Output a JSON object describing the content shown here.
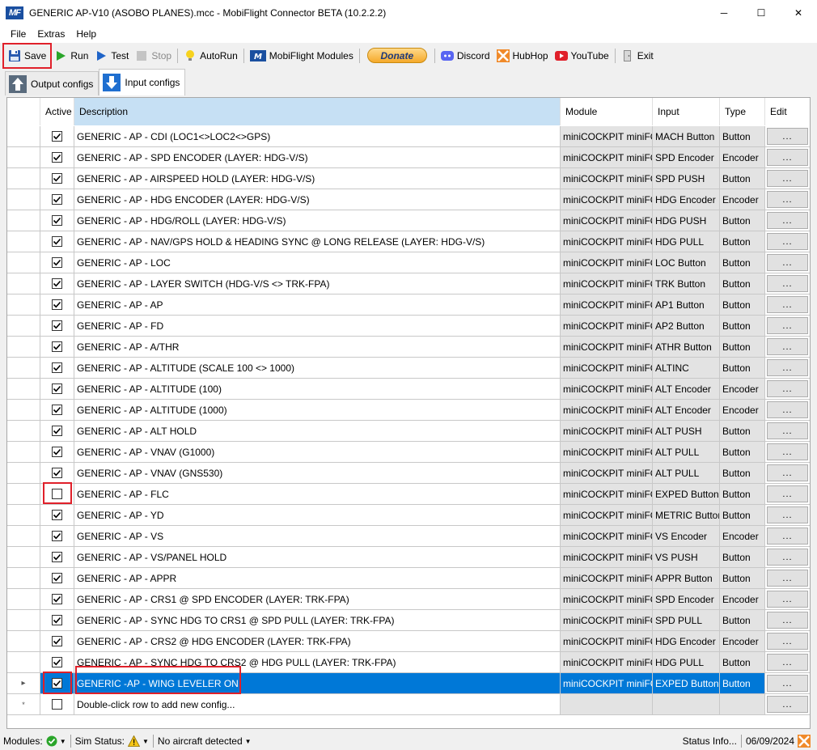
{
  "window": {
    "title": "GENERIC AP-V10 (ASOBO PLANES).mcc - MobiFlight Connector BETA (10.2.2.2)",
    "logo_text": "MF",
    "minimize_glyph": "─",
    "maximize_glyph": "☐",
    "close_glyph": "✕"
  },
  "menu": [
    "File",
    "Extras",
    "Help"
  ],
  "toolbar": {
    "save": "Save",
    "run": "Run",
    "test": "Test",
    "stop": "Stop",
    "autorun": "AutoRun",
    "modules": "MobiFlight Modules",
    "donate": "Donate",
    "discord": "Discord",
    "hubhop": "HubHop",
    "youtube": "YouTube",
    "exit": "Exit"
  },
  "tabs": [
    {
      "label": "Output configs",
      "active": false
    },
    {
      "label": "Input configs",
      "active": true
    }
  ],
  "grid": {
    "headers": {
      "active": "Active",
      "description": "Description",
      "module": "Module",
      "input": "Input",
      "type": "Type",
      "edit": "Edit"
    },
    "edit_label": "...",
    "new_row_marker": "*",
    "selected_marker": "▸",
    "new_row_text": "Double-click row to add new config...",
    "rows": [
      {
        "active": true,
        "description": "GENERIC - AP - CDI (LOC1<>LOC2<>GPS)",
        "module": "miniCOCKPIT miniFCU",
        "input": "MACH Button",
        "type": "Button"
      },
      {
        "active": true,
        "description": "GENERIC - AP - SPD ENCODER (LAYER: HDG-V/S)",
        "module": "miniCOCKPIT miniFCU",
        "input": "SPD Encoder",
        "type": "Encoder"
      },
      {
        "active": true,
        "description": "GENERIC - AP - AIRSPEED HOLD (LAYER: HDG-V/S)",
        "module": "miniCOCKPIT miniFCU",
        "input": "SPD PUSH",
        "type": "Button"
      },
      {
        "active": true,
        "description": "GENERIC - AP - HDG ENCODER (LAYER: HDG-V/S)",
        "module": "miniCOCKPIT miniFCU",
        "input": "HDG Encoder",
        "type": "Encoder"
      },
      {
        "active": true,
        "description": "GENERIC - AP - HDG/ROLL (LAYER: HDG-V/S)",
        "module": "miniCOCKPIT miniFCU",
        "input": "HDG PUSH",
        "type": "Button"
      },
      {
        "active": true,
        "description": "GENERIC - AP - NAV/GPS HOLD & HEADING SYNC @ LONG RELEASE (LAYER: HDG-V/S)",
        "module": "miniCOCKPIT miniFCU",
        "input": "HDG PULL",
        "type": "Button"
      },
      {
        "active": true,
        "description": "GENERIC - AP - LOC",
        "module": "miniCOCKPIT miniFCU",
        "input": "LOC Button",
        "type": "Button"
      },
      {
        "active": true,
        "description": "GENERIC - AP - LAYER SWITCH (HDG-V/S <> TRK-FPA)",
        "module": "miniCOCKPIT miniFCU",
        "input": "TRK Button",
        "type": "Button"
      },
      {
        "active": true,
        "description": "GENERIC - AP - AP",
        "module": "miniCOCKPIT miniFCU",
        "input": "AP1 Button",
        "type": "Button"
      },
      {
        "active": true,
        "description": "GENERIC - AP - FD",
        "module": "miniCOCKPIT miniFCU",
        "input": "AP2 Button",
        "type": "Button"
      },
      {
        "active": true,
        "description": "GENERIC - AP - A/THR",
        "module": "miniCOCKPIT miniFCU",
        "input": "ATHR Button",
        "type": "Button"
      },
      {
        "active": true,
        "description": "GENERIC - AP - ALTITUDE (SCALE 100 <> 1000)",
        "module": "miniCOCKPIT miniFCU",
        "input": "ALTINC",
        "type": "Button"
      },
      {
        "active": true,
        "description": "GENERIC - AP - ALTITUDE (100)",
        "module": "miniCOCKPIT miniFCU",
        "input": "ALT Encoder",
        "type": "Encoder"
      },
      {
        "active": true,
        "description": "GENERIC - AP - ALTITUDE (1000)",
        "module": "miniCOCKPIT miniFCU",
        "input": "ALT Encoder",
        "type": "Encoder"
      },
      {
        "active": true,
        "description": "GENERIC - AP - ALT HOLD",
        "module": "miniCOCKPIT miniFCU",
        "input": "ALT PUSH",
        "type": "Button"
      },
      {
        "active": true,
        "description": "GENERIC - AP - VNAV (G1000)",
        "module": "miniCOCKPIT miniFCU",
        "input": "ALT PULL",
        "type": "Button"
      },
      {
        "active": true,
        "description": "GENERIC - AP - VNAV (GNS530)",
        "module": "miniCOCKPIT miniFCU",
        "input": "ALT PULL",
        "type": "Button"
      },
      {
        "active": false,
        "description": "GENERIC - AP - FLC",
        "module": "miniCOCKPIT miniFCU",
        "input": "EXPED Button",
        "type": "Button"
      },
      {
        "active": true,
        "description": "GENERIC - AP - YD",
        "module": "miniCOCKPIT miniFCU",
        "input": "METRIC Button",
        "type": "Button"
      },
      {
        "active": true,
        "description": "GENERIC - AP - VS",
        "module": "miniCOCKPIT miniFCU",
        "input": "VS Encoder",
        "type": "Encoder"
      },
      {
        "active": true,
        "description": "GENERIC - AP - VS/PANEL HOLD",
        "module": "miniCOCKPIT miniFCU",
        "input": "VS PUSH",
        "type": "Button"
      },
      {
        "active": true,
        "description": "GENERIC - AP - APPR",
        "module": "miniCOCKPIT miniFCU",
        "input": "APPR Button",
        "type": "Button"
      },
      {
        "active": true,
        "description": "GENERIC - AP - CRS1 @ SPD ENCODER (LAYER: TRK-FPA)",
        "module": "miniCOCKPIT miniFCU",
        "input": "SPD Encoder",
        "type": "Encoder"
      },
      {
        "active": true,
        "description": "GENERIC - AP - SYNC HDG TO CRS1 @ SPD PULL (LAYER: TRK-FPA)",
        "module": "miniCOCKPIT miniFCU",
        "input": "SPD PULL",
        "type": "Button"
      },
      {
        "active": true,
        "description": "GENERIC - AP - CRS2 @ HDG ENCODER (LAYER: TRK-FPA)",
        "module": "miniCOCKPIT miniFCU",
        "input": "HDG Encoder",
        "type": "Encoder"
      },
      {
        "active": true,
        "description": "GENERIC - AP - SYNC HDG TO CRS2 @ HDG PULL (LAYER: TRK-FPA)",
        "module": "miniCOCKPIT miniFCU",
        "input": "HDG PULL",
        "type": "Button"
      },
      {
        "active": true,
        "description": "GENERIC -AP - WING LEVELER ON",
        "module": "miniCOCKPIT miniFCU",
        "input": "EXPED Button",
        "type": "Button",
        "selected": true
      }
    ]
  },
  "status": {
    "modules": "Modules:",
    "sim_status": "Sim Status:",
    "aircraft": "No aircraft detected",
    "status_info": "Status Info...",
    "date": "06/09/2024"
  },
  "colors": {
    "selection": "#0078d7",
    "highlight": "#e0202a",
    "header_sorted": "#c6e0f4"
  }
}
